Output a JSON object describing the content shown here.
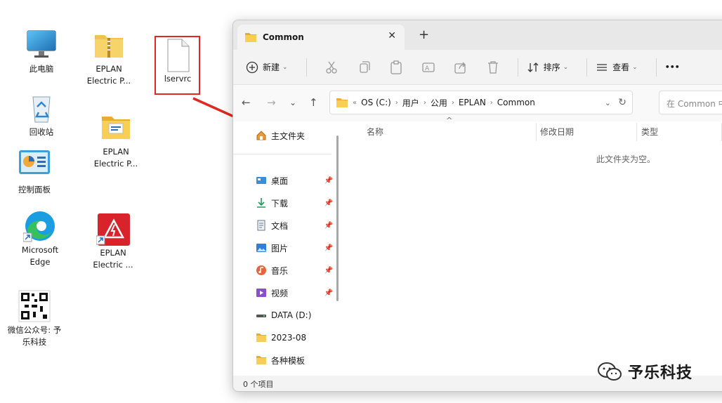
{
  "desktop": {
    "icons": [
      {
        "label": "此电脑",
        "icon": "monitor-icon"
      },
      {
        "label": "EPLAN Electric P...",
        "icon": "zip-folder-icon"
      },
      {
        "label": "lservrc",
        "icon": "file-icon"
      },
      {
        "label": "回收站",
        "icon": "recycle-bin-icon"
      },
      {
        "label": "EPLAN Electric P...",
        "icon": "folder-icon"
      },
      {
        "label": "控制面板",
        "icon": "control-panel-icon"
      },
      {
        "label": "Microsoft Edge",
        "icon": "edge-icon"
      },
      {
        "label": "EPLAN Electric ...",
        "icon": "eplan-app-icon"
      },
      {
        "label": "微信公众号: 予乐科技",
        "icon": "qr-code-icon"
      }
    ]
  },
  "explorer": {
    "tab_title": "Common",
    "toolbar": {
      "new_label": "新建",
      "sort_label": "排序",
      "view_label": "查看",
      "more_label": "•••"
    },
    "path": [
      "OS (C:)",
      "用户",
      "公用",
      "EPLAN",
      "Common"
    ],
    "search_placeholder": "在 Common 中",
    "nav": {
      "home": "主文件夹",
      "items": [
        {
          "label": "桌面",
          "pinned": true,
          "icon": "desktop-icon",
          "color": "#3b8edc"
        },
        {
          "label": "下载",
          "pinned": true,
          "icon": "download-icon",
          "color": "#1a9e5a"
        },
        {
          "label": "文档",
          "pinned": true,
          "icon": "document-icon",
          "color": "#6b7a8c"
        },
        {
          "label": "图片",
          "pinned": true,
          "icon": "picture-icon",
          "color": "#2f7fd8"
        },
        {
          "label": "音乐",
          "pinned": true,
          "icon": "music-icon",
          "color": "#e8643c"
        },
        {
          "label": "视频",
          "pinned": true,
          "icon": "video-icon",
          "color": "#8a4fd0"
        },
        {
          "label": "DATA (D:)",
          "pinned": false,
          "icon": "drive-icon",
          "color": "#555555"
        },
        {
          "label": "2023-08",
          "pinned": false,
          "icon": "folder-icon",
          "color": "#f2c14e"
        },
        {
          "label": "各种模板",
          "pinned": false,
          "icon": "folder-icon",
          "color": "#f2c14e"
        }
      ]
    },
    "columns": [
      "名称",
      "修改日期",
      "类型"
    ],
    "empty_message": "此文件夹为空。",
    "status": "0 个项目"
  },
  "watermark": "予乐科技",
  "colors": {
    "accent_red": "#e0281e",
    "folder": "#f2c14e"
  }
}
